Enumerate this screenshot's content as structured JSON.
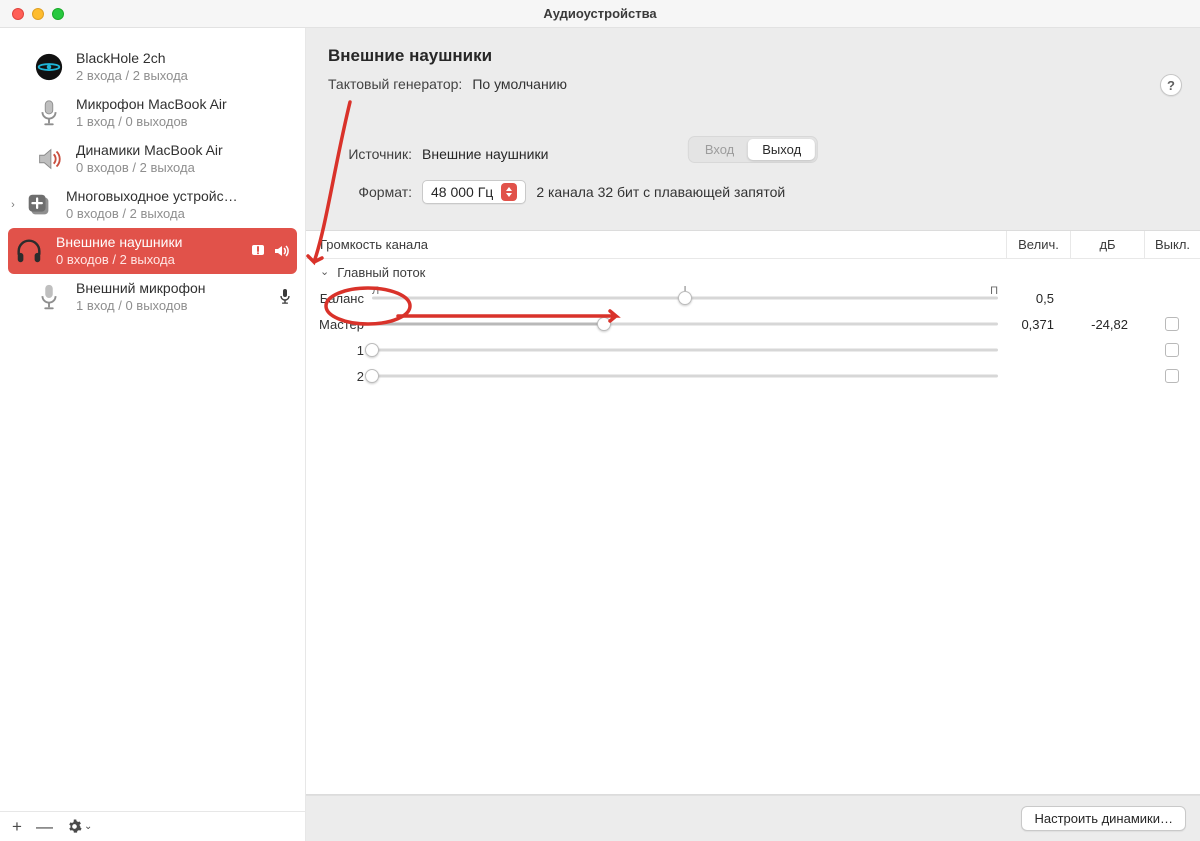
{
  "window": {
    "title": "Аудиоустройства"
  },
  "sidebar": {
    "devices": [
      {
        "name": "BlackHole 2ch",
        "sub": "2 входа / 2 выхода"
      },
      {
        "name": "Микрофон MacBook Air",
        "sub": "1 вход / 0 выходов"
      },
      {
        "name": "Динамики MacBook Air",
        "sub": "0 входов / 2 выхода"
      },
      {
        "name": "Многовыходное устройс…",
        "sub": "0 входов / 2 выхода"
      },
      {
        "name": "Внешние наушники",
        "sub": "0 входов / 2 выхода"
      },
      {
        "name": "Внешний микрофон",
        "sub": "1 вход / 0 выходов"
      }
    ]
  },
  "detail": {
    "title": "Внешние наушники",
    "clock_label": "Тактовый генератор:",
    "clock_value": "По умолчанию",
    "tabs": {
      "input": "Вход",
      "output": "Выход"
    },
    "source_label": "Источник:",
    "source_value": "Внешние наушники",
    "format_label": "Формат:",
    "format_value": "48 000 Гц",
    "format_desc": "2 канала 32 бит с плавающей запятой",
    "help": "?"
  },
  "table": {
    "header": {
      "volume": "Громкость канала",
      "value": "Велич.",
      "db": "дБ",
      "mute": "Выкл."
    },
    "stream_label": "Главный поток",
    "balance": {
      "label": "Баланс",
      "left_mark": "Л",
      "right_mark": "П",
      "value": "0,5",
      "position": 0.5
    },
    "master": {
      "label": "Мастер",
      "value": "0,371",
      "db": "-24,82",
      "position": 0.371
    },
    "ch1": {
      "label": "1"
    },
    "ch2": {
      "label": "2"
    }
  },
  "footer": {
    "configure": "Настроить динамики…"
  },
  "toolbar": {
    "add": "+",
    "remove": "—"
  }
}
